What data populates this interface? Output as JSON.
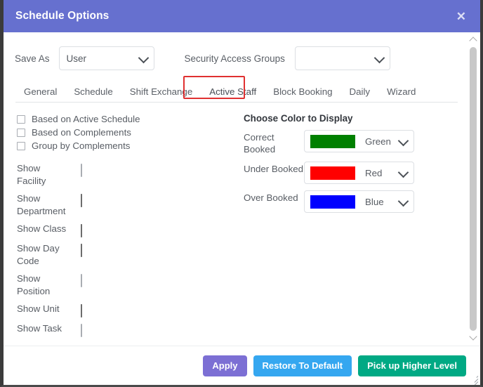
{
  "window": {
    "title": "Schedule Options",
    "close_label": "✕",
    "header_color": "#6670cf"
  },
  "toolbar": {
    "save_as_label": "Save As",
    "save_as_value": "User",
    "security_access_groups_label": "Security Access Groups",
    "security_access_groups_value": ""
  },
  "tabs": [
    {
      "label": "General",
      "active": false
    },
    {
      "label": "Schedule",
      "active": false
    },
    {
      "label": "Shift Exchange",
      "active": false
    },
    {
      "label": "Active Staff",
      "active": true
    },
    {
      "label": "Block Booking",
      "active": false
    },
    {
      "label": "Daily",
      "active": false
    },
    {
      "label": "Wizard",
      "active": false
    }
  ],
  "highlight": {
    "target_tab": "Active Staff",
    "color": "#e03131"
  },
  "left_pane": {
    "simple_checkboxes": [
      {
        "label": "Based on Active Schedule",
        "checked": false
      },
      {
        "label": "Based on Complements",
        "checked": false
      },
      {
        "label": "Group by Complements",
        "checked": false
      }
    ],
    "show_options": [
      {
        "label": "Show Facility",
        "checked": false
      },
      {
        "label": "Show Department",
        "checked": true
      },
      {
        "label": "Show Class",
        "checked": true
      },
      {
        "label": "Show Day Code",
        "checked": true
      },
      {
        "label": "Show Position",
        "checked": false
      },
      {
        "label": "Show Unit",
        "checked": true
      },
      {
        "label": "Show Task",
        "checked": false
      }
    ]
  },
  "right_pane": {
    "title": "Choose Color to Display",
    "color_rows": [
      {
        "label": "Correct Booked",
        "color_name": "Green",
        "hex": "#008000"
      },
      {
        "label": "Under Booked",
        "color_name": "Red",
        "hex": "#ff0000"
      },
      {
        "label": "Over Booked",
        "color_name": "Blue",
        "hex": "#0000ff"
      }
    ]
  },
  "footer": {
    "apply_label": "Apply",
    "restore_label": "Restore To Default",
    "pickup_label": "Pick up Higher Level",
    "apply_color": "#7c6fd4",
    "restore_color": "#35a7f0",
    "pickup_color": "#00a984"
  }
}
